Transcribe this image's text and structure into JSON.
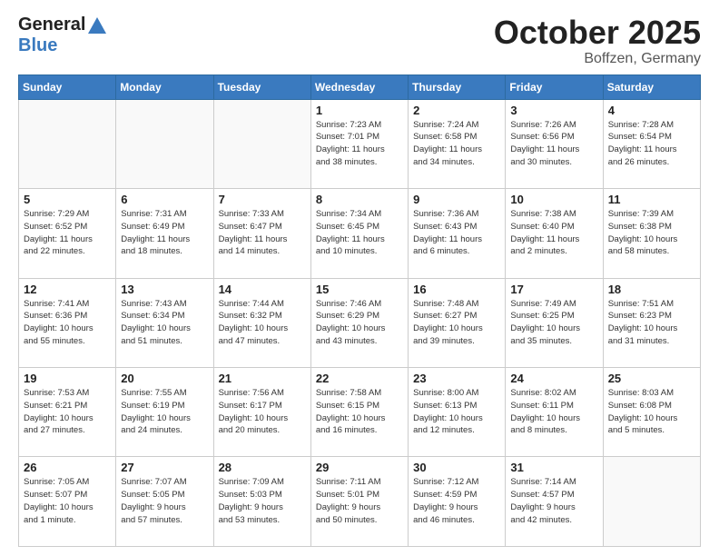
{
  "header": {
    "logo_general": "General",
    "logo_blue": "Blue",
    "month": "October 2025",
    "location": "Boffzen, Germany"
  },
  "weekdays": [
    "Sunday",
    "Monday",
    "Tuesday",
    "Wednesday",
    "Thursday",
    "Friday",
    "Saturday"
  ],
  "weeks": [
    [
      {
        "day": "",
        "info": ""
      },
      {
        "day": "",
        "info": ""
      },
      {
        "day": "",
        "info": ""
      },
      {
        "day": "1",
        "info": "Sunrise: 7:23 AM\nSunset: 7:01 PM\nDaylight: 11 hours\nand 38 minutes."
      },
      {
        "day": "2",
        "info": "Sunrise: 7:24 AM\nSunset: 6:58 PM\nDaylight: 11 hours\nand 34 minutes."
      },
      {
        "day": "3",
        "info": "Sunrise: 7:26 AM\nSunset: 6:56 PM\nDaylight: 11 hours\nand 30 minutes."
      },
      {
        "day": "4",
        "info": "Sunrise: 7:28 AM\nSunset: 6:54 PM\nDaylight: 11 hours\nand 26 minutes."
      }
    ],
    [
      {
        "day": "5",
        "info": "Sunrise: 7:29 AM\nSunset: 6:52 PM\nDaylight: 11 hours\nand 22 minutes."
      },
      {
        "day": "6",
        "info": "Sunrise: 7:31 AM\nSunset: 6:49 PM\nDaylight: 11 hours\nand 18 minutes."
      },
      {
        "day": "7",
        "info": "Sunrise: 7:33 AM\nSunset: 6:47 PM\nDaylight: 11 hours\nand 14 minutes."
      },
      {
        "day": "8",
        "info": "Sunrise: 7:34 AM\nSunset: 6:45 PM\nDaylight: 11 hours\nand 10 minutes."
      },
      {
        "day": "9",
        "info": "Sunrise: 7:36 AM\nSunset: 6:43 PM\nDaylight: 11 hours\nand 6 minutes."
      },
      {
        "day": "10",
        "info": "Sunrise: 7:38 AM\nSunset: 6:40 PM\nDaylight: 11 hours\nand 2 minutes."
      },
      {
        "day": "11",
        "info": "Sunrise: 7:39 AM\nSunset: 6:38 PM\nDaylight: 10 hours\nand 58 minutes."
      }
    ],
    [
      {
        "day": "12",
        "info": "Sunrise: 7:41 AM\nSunset: 6:36 PM\nDaylight: 10 hours\nand 55 minutes."
      },
      {
        "day": "13",
        "info": "Sunrise: 7:43 AM\nSunset: 6:34 PM\nDaylight: 10 hours\nand 51 minutes."
      },
      {
        "day": "14",
        "info": "Sunrise: 7:44 AM\nSunset: 6:32 PM\nDaylight: 10 hours\nand 47 minutes."
      },
      {
        "day": "15",
        "info": "Sunrise: 7:46 AM\nSunset: 6:29 PM\nDaylight: 10 hours\nand 43 minutes."
      },
      {
        "day": "16",
        "info": "Sunrise: 7:48 AM\nSunset: 6:27 PM\nDaylight: 10 hours\nand 39 minutes."
      },
      {
        "day": "17",
        "info": "Sunrise: 7:49 AM\nSunset: 6:25 PM\nDaylight: 10 hours\nand 35 minutes."
      },
      {
        "day": "18",
        "info": "Sunrise: 7:51 AM\nSunset: 6:23 PM\nDaylight: 10 hours\nand 31 minutes."
      }
    ],
    [
      {
        "day": "19",
        "info": "Sunrise: 7:53 AM\nSunset: 6:21 PM\nDaylight: 10 hours\nand 27 minutes."
      },
      {
        "day": "20",
        "info": "Sunrise: 7:55 AM\nSunset: 6:19 PM\nDaylight: 10 hours\nand 24 minutes."
      },
      {
        "day": "21",
        "info": "Sunrise: 7:56 AM\nSunset: 6:17 PM\nDaylight: 10 hours\nand 20 minutes."
      },
      {
        "day": "22",
        "info": "Sunrise: 7:58 AM\nSunset: 6:15 PM\nDaylight: 10 hours\nand 16 minutes."
      },
      {
        "day": "23",
        "info": "Sunrise: 8:00 AM\nSunset: 6:13 PM\nDaylight: 10 hours\nand 12 minutes."
      },
      {
        "day": "24",
        "info": "Sunrise: 8:02 AM\nSunset: 6:11 PM\nDaylight: 10 hours\nand 8 minutes."
      },
      {
        "day": "25",
        "info": "Sunrise: 8:03 AM\nSunset: 6:08 PM\nDaylight: 10 hours\nand 5 minutes."
      }
    ],
    [
      {
        "day": "26",
        "info": "Sunrise: 7:05 AM\nSunset: 5:07 PM\nDaylight: 10 hours\nand 1 minute."
      },
      {
        "day": "27",
        "info": "Sunrise: 7:07 AM\nSunset: 5:05 PM\nDaylight: 9 hours\nand 57 minutes."
      },
      {
        "day": "28",
        "info": "Sunrise: 7:09 AM\nSunset: 5:03 PM\nDaylight: 9 hours\nand 53 minutes."
      },
      {
        "day": "29",
        "info": "Sunrise: 7:11 AM\nSunset: 5:01 PM\nDaylight: 9 hours\nand 50 minutes."
      },
      {
        "day": "30",
        "info": "Sunrise: 7:12 AM\nSunset: 4:59 PM\nDaylight: 9 hours\nand 46 minutes."
      },
      {
        "day": "31",
        "info": "Sunrise: 7:14 AM\nSunset: 4:57 PM\nDaylight: 9 hours\nand 42 minutes."
      },
      {
        "day": "",
        "info": ""
      }
    ]
  ]
}
